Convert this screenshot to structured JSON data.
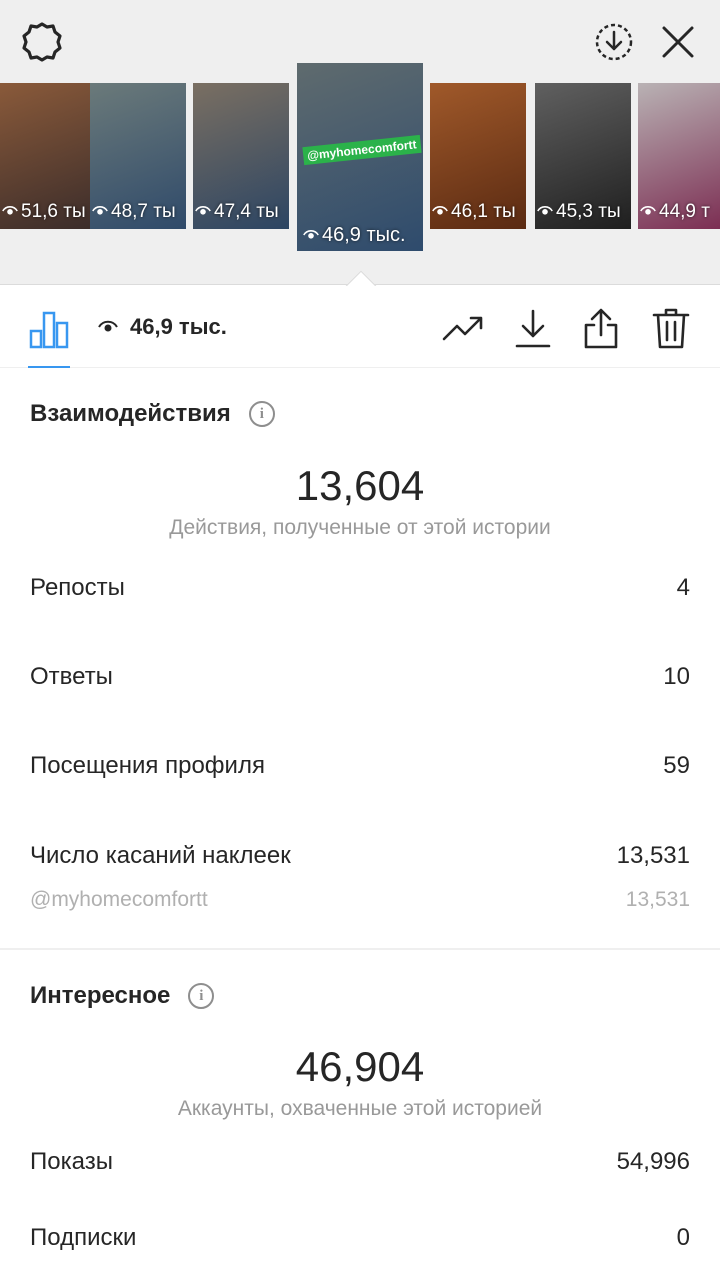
{
  "top": {
    "icons": {
      "settings": "settings-gear-icon",
      "download": "download-circle-icon",
      "close": "close-icon"
    }
  },
  "thumbnails": [
    {
      "views": "51,6 ты",
      "colors": [
        "#8a5a3a",
        "#3a2c2a"
      ]
    },
    {
      "views": "48,7 ты",
      "colors": [
        "#6b7a7a",
        "#2f4a6a"
      ]
    },
    {
      "views": "47,4 ты",
      "colors": [
        "#7a6f62",
        "#2c4563"
      ]
    },
    {
      "views": "46,9 тыс.",
      "tag": "@myhomecomfortt",
      "selected": true,
      "colors": [
        "#5f6b6e",
        "#2e4b6d"
      ]
    },
    {
      "views": "46,1 ты",
      "colors": [
        "#a0592a",
        "#5a2a12"
      ]
    },
    {
      "views": "45,3 ты",
      "colors": [
        "#606060",
        "#1f1f1f"
      ]
    },
    {
      "views": "44,9 т",
      "colors": [
        "#b9b2b4",
        "#7a2a50"
      ]
    }
  ],
  "actionbar": {
    "views": "46,9 тыс.",
    "icons": [
      "bar-chart-icon",
      "eye-icon",
      "trending-icon",
      "download-icon",
      "share-icon",
      "trash-icon"
    ],
    "accent": "#3897f0"
  },
  "interactions": {
    "title": "Взаимодействия",
    "total": "13,604",
    "caption": "Действия, полученные от этой истории",
    "rows": [
      {
        "label": "Репосты",
        "value": "4"
      },
      {
        "label": "Ответы",
        "value": "10"
      },
      {
        "label": "Посещения профиля",
        "value": "59"
      },
      {
        "label": "Число касаний наклеек",
        "value": "13,531"
      }
    ],
    "sub_row": {
      "label": "@myhomecomfortt",
      "value": "13,531"
    }
  },
  "discovery": {
    "title": "Интересное",
    "total": "46,904",
    "caption": "Аккаунты, охваченные этой историей",
    "rows": [
      {
        "label": "Показы",
        "value": "54,996"
      },
      {
        "label": "Подписки",
        "value": "0"
      }
    ]
  }
}
